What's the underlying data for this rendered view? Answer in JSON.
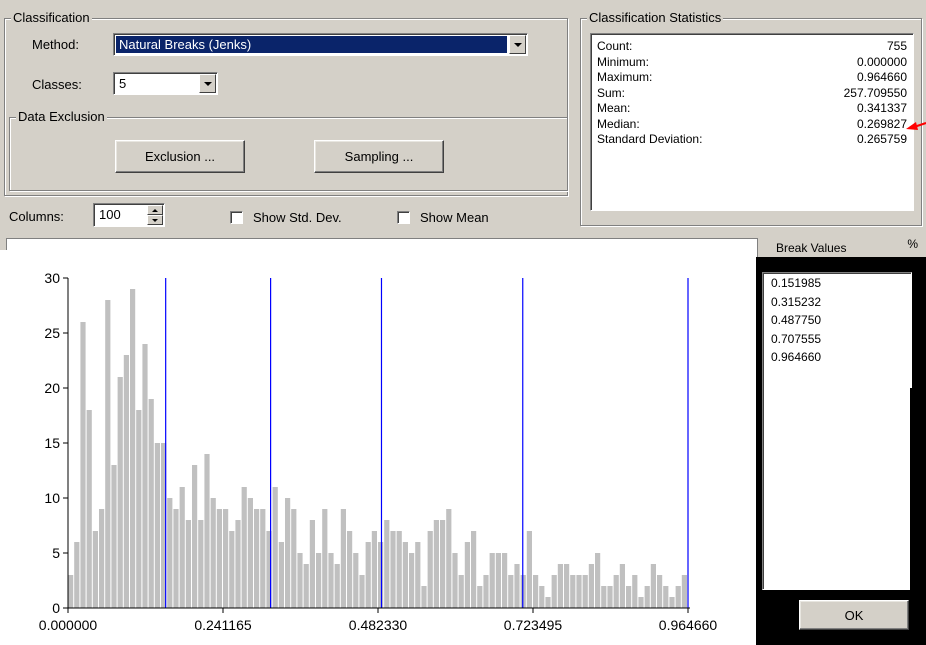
{
  "classification": {
    "group_title": "Classification",
    "method_label": "Method:",
    "method_value": "Natural Breaks (Jenks)",
    "classes_label": "Classes:",
    "classes_value": "5"
  },
  "data_exclusion": {
    "group_title": "Data Exclusion",
    "exclusion_button": "Exclusion ...",
    "sampling_button": "Sampling ..."
  },
  "columns": {
    "label": "Columns:",
    "value": "100"
  },
  "show_std_dev": {
    "label": "Show Std. Dev.",
    "checked": false
  },
  "show_mean": {
    "label": "Show Mean",
    "checked": false
  },
  "statistics": {
    "group_title": "Classification Statistics",
    "rows": [
      {
        "key": "Count:",
        "value": "755"
      },
      {
        "key": "Minimum:",
        "value": "0.000000"
      },
      {
        "key": "Maximum:",
        "value": "0.964660"
      },
      {
        "key": "Sum:",
        "value": "257.709550"
      },
      {
        "key": "Mean:",
        "value": "0.341337"
      },
      {
        "key": "Median:",
        "value": "0.269827"
      },
      {
        "key": "Standard Deviation:",
        "value": "0.265759"
      }
    ]
  },
  "break_values": {
    "header": "Break Values",
    "percent_label": "%",
    "items": [
      "0.151985",
      "0.315232",
      "0.487750",
      "0.707555",
      "0.964660"
    ]
  },
  "ok_button": "OK",
  "colors": {
    "window_bg": "#d4d0c8",
    "selection_bg": "#0a246a",
    "histogram_bar": "#c0c0c0",
    "break_line": "#0000ff",
    "arrow": "#ff0000"
  },
  "chart_data": {
    "type": "bar",
    "x_range": [
      0.0,
      0.96466
    ],
    "x_ticks": [
      "0.000000",
      "0.241165",
      "0.482330",
      "0.723495",
      "0.964660"
    ],
    "y_range": [
      0,
      30
    ],
    "y_ticks": [
      "0",
      "5",
      "10",
      "15",
      "20",
      "25",
      "30"
    ],
    "bin_count": 100,
    "values": [
      3,
      6,
      26,
      18,
      7,
      9,
      28,
      13,
      21,
      23,
      29,
      18,
      24,
      19,
      15,
      15,
      10,
      9,
      11,
      8,
      13,
      8,
      14,
      10,
      9,
      9,
      7,
      8,
      11,
      10,
      9,
      9,
      7,
      11,
      6,
      10,
      9,
      5,
      4,
      8,
      5,
      9,
      5,
      4,
      9,
      7,
      5,
      3,
      6,
      7,
      6,
      8,
      7,
      7,
      6,
      5,
      6,
      2,
      7,
      8,
      8,
      9,
      5,
      3,
      6,
      7,
      2,
      3,
      5,
      5,
      5,
      3,
      4,
      3,
      7,
      3,
      2,
      1,
      3,
      4,
      4,
      3,
      3,
      3,
      4,
      5,
      2,
      2,
      3,
      4,
      2,
      3,
      1,
      2,
      4,
      3,
      2,
      1,
      2,
      3
    ],
    "breaks": [
      0.151985,
      0.315232,
      0.48775,
      0.707555,
      0.96466
    ]
  }
}
